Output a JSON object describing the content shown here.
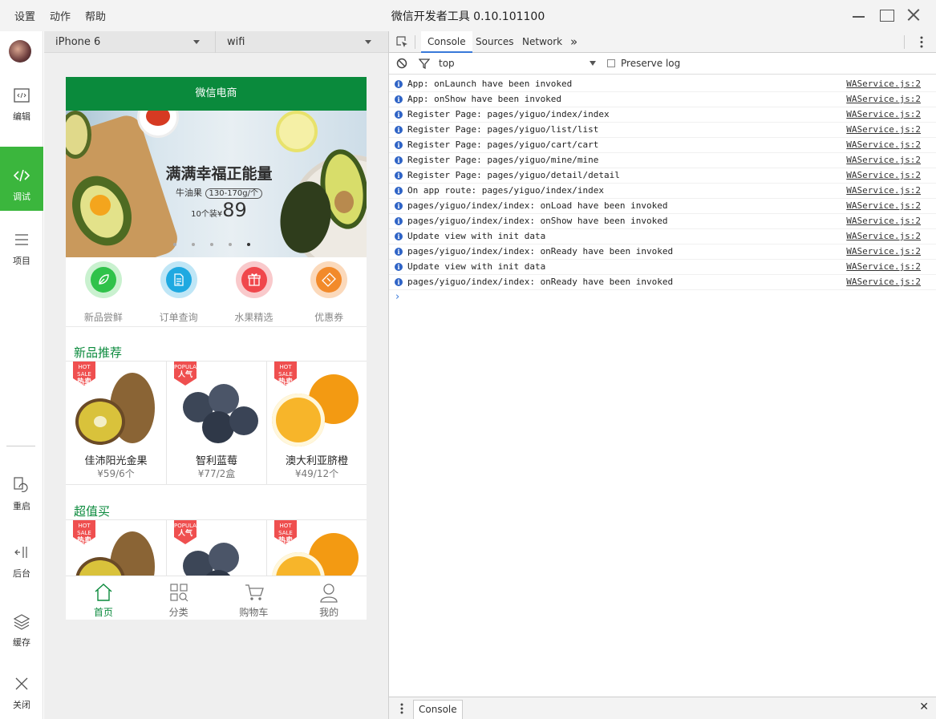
{
  "menu": [
    "设置",
    "动作",
    "帮助"
  ],
  "app_title": "微信开发者工具 0.10.101100",
  "sidebar": {
    "items": [
      {
        "label": "编辑",
        "icon": "code-file-icon"
      },
      {
        "label": "调试",
        "icon": "code-icon",
        "active": true
      },
      {
        "label": "项目",
        "icon": "menu-icon"
      },
      {
        "label": "重启",
        "icon": "restart-icon"
      },
      {
        "label": "后台",
        "icon": "background-icon"
      },
      {
        "label": "缓存",
        "icon": "layers-icon"
      },
      {
        "label": "关闭",
        "icon": "close-icon"
      }
    ]
  },
  "simulator": {
    "device": "iPhone 6",
    "network": "wifi",
    "nav_title": "微信电商",
    "banner": {
      "title": "满满幸福正能量",
      "subtitle": "牛油果",
      "spec": "130-170g/个",
      "count": "10个装",
      "currency": "¥",
      "price": "89"
    },
    "categories": [
      {
        "label": "新品尝鲜",
        "color": "#2fc24a"
      },
      {
        "label": "订单查询",
        "color": "#1fa9e1"
      },
      {
        "label": "水果精选",
        "color": "#f0474c"
      },
      {
        "label": "优惠券",
        "color": "#f28a2a"
      }
    ],
    "sections": [
      {
        "title": "新品推荐"
      },
      {
        "title": "超值买"
      }
    ],
    "products": [
      {
        "tag_top": "HOT SALE",
        "tag": "热卖",
        "name": "佳沛阳光金果",
        "price": "¥59/6个"
      },
      {
        "tag_top": "POPULAR",
        "tag": "人气",
        "name": "智利蓝莓",
        "price": "¥77/2盒"
      },
      {
        "tag_top": "HOT SALE",
        "tag": "热卖",
        "name": "澳大利亚脐橙",
        "price": "¥49/12个"
      }
    ],
    "tabs": [
      {
        "label": "首页",
        "active": true
      },
      {
        "label": "分类"
      },
      {
        "label": "购物车"
      },
      {
        "label": "我的"
      }
    ]
  },
  "devtools": {
    "tabs": [
      "Console",
      "Sources",
      "Network"
    ],
    "more": "»",
    "context": "top",
    "preserve_log": "Preserve log",
    "log": [
      {
        "msg": "App: onLaunch have been invoked",
        "src": "WAService.js:2"
      },
      {
        "msg": "App: onShow have been invoked",
        "src": "WAService.js:2"
      },
      {
        "msg": "Register Page: pages/yiguo/index/index",
        "src": "WAService.js:2"
      },
      {
        "msg": "Register Page: pages/yiguo/list/list",
        "src": "WAService.js:2"
      },
      {
        "msg": "Register Page: pages/yiguo/cart/cart",
        "src": "WAService.js:2"
      },
      {
        "msg": "Register Page: pages/yiguo/mine/mine",
        "src": "WAService.js:2"
      },
      {
        "msg": "Register Page: pages/yiguo/detail/detail",
        "src": "WAService.js:2"
      },
      {
        "msg": "On app route: pages/yiguo/index/index",
        "src": "WAService.js:2"
      },
      {
        "msg": "pages/yiguo/index/index: onLoad have been invoked",
        "src": "WAService.js:2"
      },
      {
        "msg": "pages/yiguo/index/index: onShow have been invoked",
        "src": "WAService.js:2"
      },
      {
        "msg": "Update view with init data",
        "src": "WAService.js:2"
      },
      {
        "msg": "pages/yiguo/index/index: onReady have been invoked",
        "src": "WAService.js:2"
      },
      {
        "msg": "Update view with init data",
        "src": "WAService.js:2"
      },
      {
        "msg": "pages/yiguo/index/index: onReady have been invoked",
        "src": "WAService.js:2"
      }
    ],
    "prompt": "›",
    "drawer_tab": "Console",
    "drawer_close": "✕"
  }
}
